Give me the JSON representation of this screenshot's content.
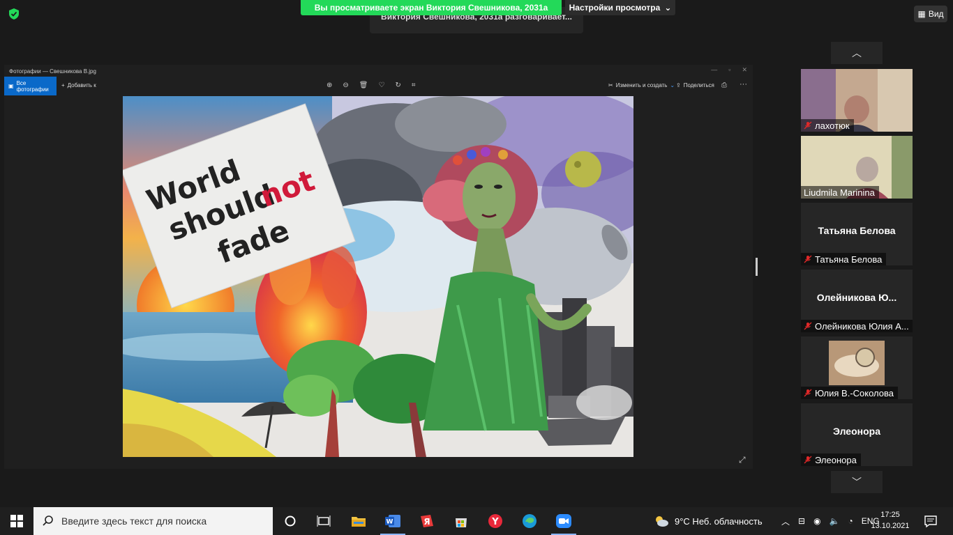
{
  "banner": {
    "sharing_text": "Вы просматриваете экран Виктория Свешникова, 2031а",
    "view_settings_label": "Настройки просмотра",
    "speaking_text": "Виктория Свешникова, 2031а разговаривает...",
    "view_button_label": "Вид"
  },
  "photos_app": {
    "window_title": "Фотографии — Свешникова В.jpg",
    "all_photos_label": "Все фотографии",
    "add_label": "Добавить к",
    "edit_create_label": "Изменить и создать",
    "share_label": "Поделиться"
  },
  "painting": {
    "sign_line1": "World",
    "sign_line2": "should",
    "sign_line3": "not",
    "sign_line4": "fade"
  },
  "participants": [
    {
      "name": "лахотюк",
      "muted": true,
      "video": true
    },
    {
      "name": "Liudmila Marinina",
      "muted": false,
      "video": true
    },
    {
      "name": "Татьяна Белова",
      "big_name": "Татьяна Белова",
      "muted": true,
      "video": false
    },
    {
      "name": "Олейникова Юлия А...",
      "big_name": "Олейникова  Ю...",
      "muted": true,
      "video": false
    },
    {
      "name": "Юлия В.-Соколова",
      "muted": true,
      "video": true
    },
    {
      "name": "Элеонора",
      "big_name": "Элеонора",
      "muted": true,
      "video": false
    }
  ],
  "taskbar": {
    "search_placeholder": "Введите здесь текст для поиска",
    "weather": "9°C  Неб. облачность",
    "language": "ENG",
    "time": "17:25",
    "date": "13.10.2021"
  },
  "colors": {
    "share_green": "#23d959",
    "photos_accent": "#0a69c9",
    "muted_red": "#e02828"
  }
}
